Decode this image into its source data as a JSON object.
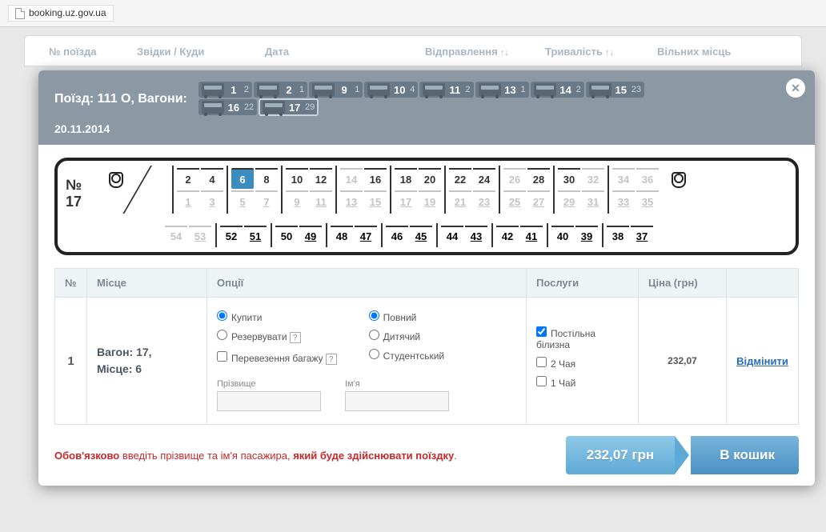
{
  "browser": {
    "url": "booking.uz.gov.ua"
  },
  "bgcols": {
    "train": "№ поїзда",
    "route": "Звідки / Куди",
    "date": "Дата",
    "depart": "Відправлення",
    "dur": "Тривалість",
    "free": "Вільних місць"
  },
  "modal": {
    "title": "Поїзд: 111 О, Вагони:",
    "date": "20.11.2014",
    "wagons": [
      {
        "n": "1",
        "free": "2"
      },
      {
        "n": "2",
        "free": "1"
      },
      {
        "n": "9",
        "free": "1"
      },
      {
        "n": "10",
        "free": "4"
      },
      {
        "n": "11",
        "free": "2"
      },
      {
        "n": "13",
        "free": "1"
      },
      {
        "n": "14",
        "free": "2"
      },
      {
        "n": "15",
        "free": "23"
      },
      {
        "n": "16",
        "free": "22"
      },
      {
        "n": "17",
        "free": "29",
        "sel": true
      }
    ]
  },
  "coach": {
    "label_no": "№",
    "label_num": "17",
    "coupes": [
      {
        "tl": "2",
        "tr": "4",
        "bl": "1",
        "br": "3",
        "occ": [
          "1",
          "3"
        ]
      },
      {
        "tl": "6",
        "tr": "8",
        "bl": "5",
        "br": "7",
        "sel": [
          "6"
        ],
        "occ": [
          "5",
          "7"
        ]
      },
      {
        "tl": "10",
        "tr": "12",
        "bl": "9",
        "br": "11",
        "occ": [
          "9",
          "11"
        ]
      },
      {
        "tl": "14",
        "tr": "16",
        "bl": "13",
        "br": "15",
        "occ": [
          "13",
          "14",
          "15"
        ]
      },
      {
        "tl": "18",
        "tr": "20",
        "bl": "17",
        "br": "19",
        "occ": [
          "17",
          "19"
        ]
      },
      {
        "tl": "22",
        "tr": "24",
        "bl": "21",
        "br": "23",
        "occ": [
          "21",
          "23"
        ]
      },
      {
        "tl": "26",
        "tr": "28",
        "bl": "25",
        "br": "27",
        "occ": [
          "25",
          "26",
          "27"
        ]
      },
      {
        "tl": "30",
        "tr": "32",
        "bl": "29",
        "br": "31",
        "occ": [
          "29",
          "31",
          "32"
        ]
      },
      {
        "tl": "34",
        "tr": "36",
        "bl": "33",
        "br": "35",
        "occ": [
          "33",
          "34",
          "35",
          "36"
        ]
      }
    ],
    "side": [
      {
        "u": "54",
        "l": "53",
        "occ": [
          "54",
          "53"
        ]
      },
      {
        "u": "52",
        "l": "51"
      },
      {
        "u": "50",
        "l": "49"
      },
      {
        "u": "48",
        "l": "47"
      },
      {
        "u": "46",
        "l": "45"
      },
      {
        "u": "44",
        "l": "43"
      },
      {
        "u": "42",
        "l": "41"
      },
      {
        "u": "40",
        "l": "39"
      },
      {
        "u": "38",
        "l": "37"
      }
    ]
  },
  "table": {
    "th_no": "№",
    "th_place": "Місце",
    "th_opts": "Опції",
    "th_serv": "Послуги",
    "th_price": "Ціна (грн)",
    "row_no": "1",
    "place_wagon": "Вагон: 17,",
    "place_seat": "Місце: 6",
    "opt_buy": "Купити",
    "opt_res": "Резервувати",
    "opt_bag": "Перевезення багажу",
    "fare_full": "Повний",
    "fare_child": "Дитячий",
    "fare_stud": "Студентський",
    "lbl_last": "Прізвище",
    "lbl_first": "Ім'я",
    "srv_bed": "Постільна білизна",
    "srv_2tea": "2 Чая",
    "srv_1tea": "1 Чай",
    "price": "232,07",
    "cancel": "Відмінити"
  },
  "footer": {
    "warn1": "Обов'язково",
    "warn2": " введіть прізвище та ім'я пасажира, ",
    "warn3": "який буде здійснювати поїздку",
    "warn4": ".",
    "total": "232,07 грн",
    "cart": "В кошик"
  }
}
